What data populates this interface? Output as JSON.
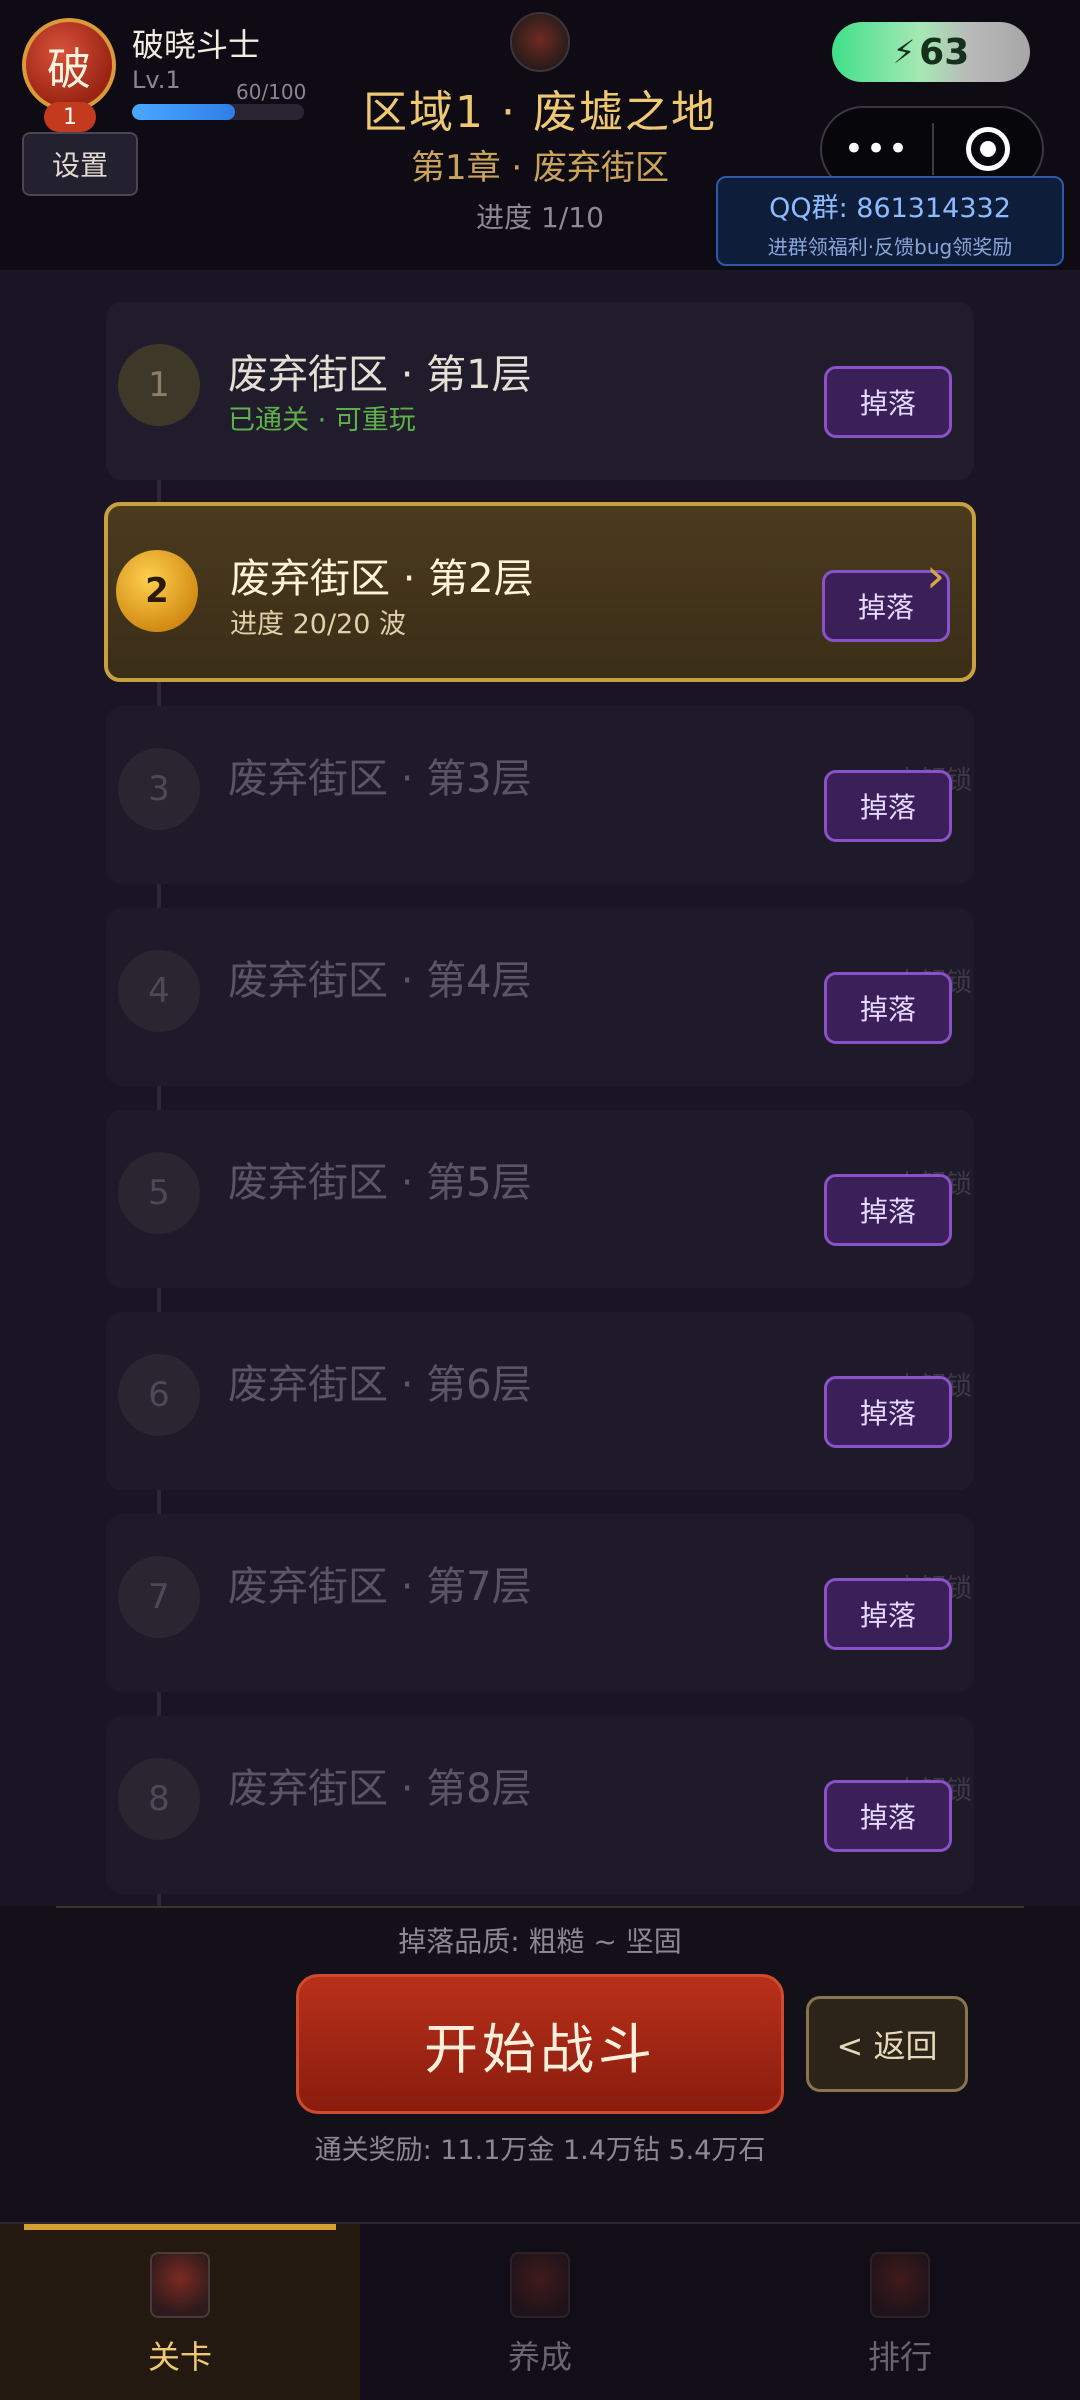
{
  "player": {
    "avatar_char": "破",
    "level_badge": "1",
    "name": "破晓斗士",
    "level": "Lv.1",
    "exp_text": "60/100",
    "exp_fraction": 0.6
  },
  "settings_label": "设置",
  "energy": {
    "value": "63",
    "icon": "⚡"
  },
  "capsule": {
    "more": "•••"
  },
  "region_title": "区域1 · 废墟之地",
  "chapter_title": "第1章 · 废弃街区",
  "progress_title": "进度 1/10",
  "qq": {
    "title": "QQ群: 861314332",
    "subtitle": "进群领福利·反馈bug领奖励"
  },
  "stages": [
    {
      "num": "1",
      "name": "废弃街区 · 第1层",
      "sub": "已通关 · 可重玩",
      "drop": "掉落",
      "locked": ""
    },
    {
      "num": "2",
      "name": "废弃街区 · 第2层",
      "sub": "进度 20/20 波",
      "drop": "掉落",
      "locked": "",
      "arrow": "›"
    },
    {
      "num": "3",
      "name": "废弃街区 · 第3层",
      "sub": "",
      "drop": "掉落",
      "locked": "未解锁"
    },
    {
      "num": "4",
      "name": "废弃街区 · 第4层",
      "sub": "",
      "drop": "掉落",
      "locked": "未解锁"
    },
    {
      "num": "5",
      "name": "废弃街区 · 第5层",
      "sub": "",
      "drop": "掉落",
      "locked": "未解锁"
    },
    {
      "num": "6",
      "name": "废弃街区 · 第6层",
      "sub": "",
      "drop": "掉落",
      "locked": "未解锁"
    },
    {
      "num": "7",
      "name": "废弃街区 · 第7层",
      "sub": "",
      "drop": "掉落",
      "locked": "未解锁"
    },
    {
      "num": "8",
      "name": "废弃街区 · 第8层",
      "sub": "",
      "drop": "掉落",
      "locked": "未解锁"
    }
  ],
  "drop_quality": "掉落品质: 粗糙 ~ 坚固",
  "start_label": "开始战斗",
  "back_label": "< 返回",
  "reward_text": "通关奖励: 11.1万金 1.4万钻 5.4万石",
  "tabs": [
    {
      "label": "关卡",
      "icon": "stage-icon"
    },
    {
      "label": "养成",
      "icon": "upgrade-icon"
    },
    {
      "label": "排行",
      "icon": "ranking-icon"
    }
  ],
  "colors": {
    "accent_gold": "#efc872",
    "drop_purple": "#8a52c8",
    "start_red": "#b8301a"
  }
}
